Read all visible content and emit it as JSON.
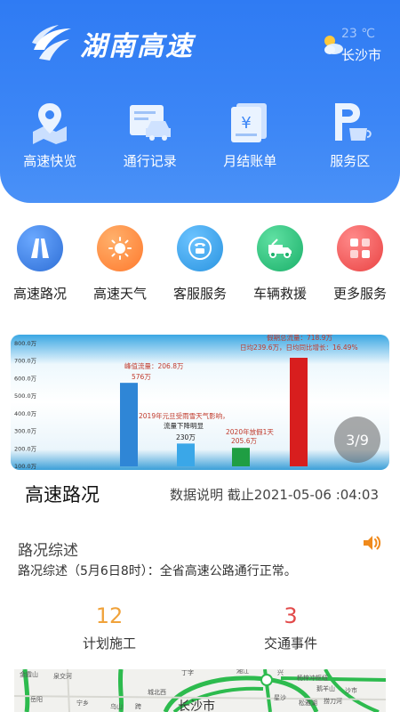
{
  "header": {
    "logo_text": "湖南高速",
    "weather": {
      "temp": "23 ℃",
      "city": "长沙市"
    },
    "quick_items": [
      {
        "label": "高速快览",
        "icon": "map-pin-icon"
      },
      {
        "label": "通行记录",
        "icon": "car-record-icon"
      },
      {
        "label": "月结账单",
        "icon": "yen-bill-icon"
      },
      {
        "label": "服务区",
        "icon": "parking-coffee-icon"
      }
    ]
  },
  "services": [
    {
      "label": "高速路况",
      "icon": "road-icon",
      "color": "#3d7fe0"
    },
    {
      "label": "高速天气",
      "icon": "sun-icon",
      "color": "#ff8a3d"
    },
    {
      "label": "客服服务",
      "icon": "phone-icon",
      "color": "#2e9fe8"
    },
    {
      "label": "车辆救援",
      "icon": "tow-truck-icon",
      "color": "#22c07a"
    },
    {
      "label": "更多服务",
      "icon": "grid-icon",
      "color": "#f25454"
    }
  ],
  "banner": {
    "page_indicator": "3/9",
    "y_ticks": [
      "800.0万",
      "700.0万",
      "600.0万",
      "500.0万",
      "400.0万",
      "300.0万",
      "200.0万",
      "100.0万"
    ],
    "annotations": {
      "peak_label": "峰值流量：206.8万",
      "peak_value": "576万",
      "snow_line1": "2019年元旦受雨雪天气影响，",
      "snow_line2": "流量下降明显",
      "snow_value": "230万",
      "y2020_label": "2020年放假1天",
      "y2020_value": "205.6万",
      "top_line1": "假期总流量：718.9万",
      "top_line2": "日均239.6万，日均同比增长：16.49%"
    }
  },
  "chart_data": {
    "type": "bar",
    "title": "",
    "xlabel": "",
    "ylabel": "",
    "ylim": [
      100,
      800
    ],
    "y_unit": "万",
    "categories": [
      "",
      "",
      "",
      ""
    ],
    "values": [
      576,
      230,
      205.6,
      718.9
    ],
    "colors": [
      "#2f86d6",
      "#3aa7e8",
      "#1f9e43",
      "#d81e1e"
    ]
  },
  "section": {
    "title": "高速路况",
    "meta": "数据说明  截止2021-05-06 :04:03"
  },
  "road_summary": {
    "title": "路况综述",
    "text": "路况综述（5月6日8时）：全省高速公路通行正常。"
  },
  "stats": [
    {
      "value": "12",
      "label": "计划施工",
      "color": "#f0a23a"
    },
    {
      "value": "3",
      "label": "交通事件",
      "color": "#e24a4a"
    }
  ],
  "map": {
    "labels": [
      "金霞山",
      "泉交河",
      "丁字",
      "湘江",
      "兴",
      "杨梓冲枢纽",
      "鹅羊山",
      "捞刀河",
      "沙市",
      "城北西",
      "岳阳",
      "长沙市",
      "星沙",
      "松雅湖",
      "乌山",
      "跨",
      "宁乡"
    ]
  }
}
